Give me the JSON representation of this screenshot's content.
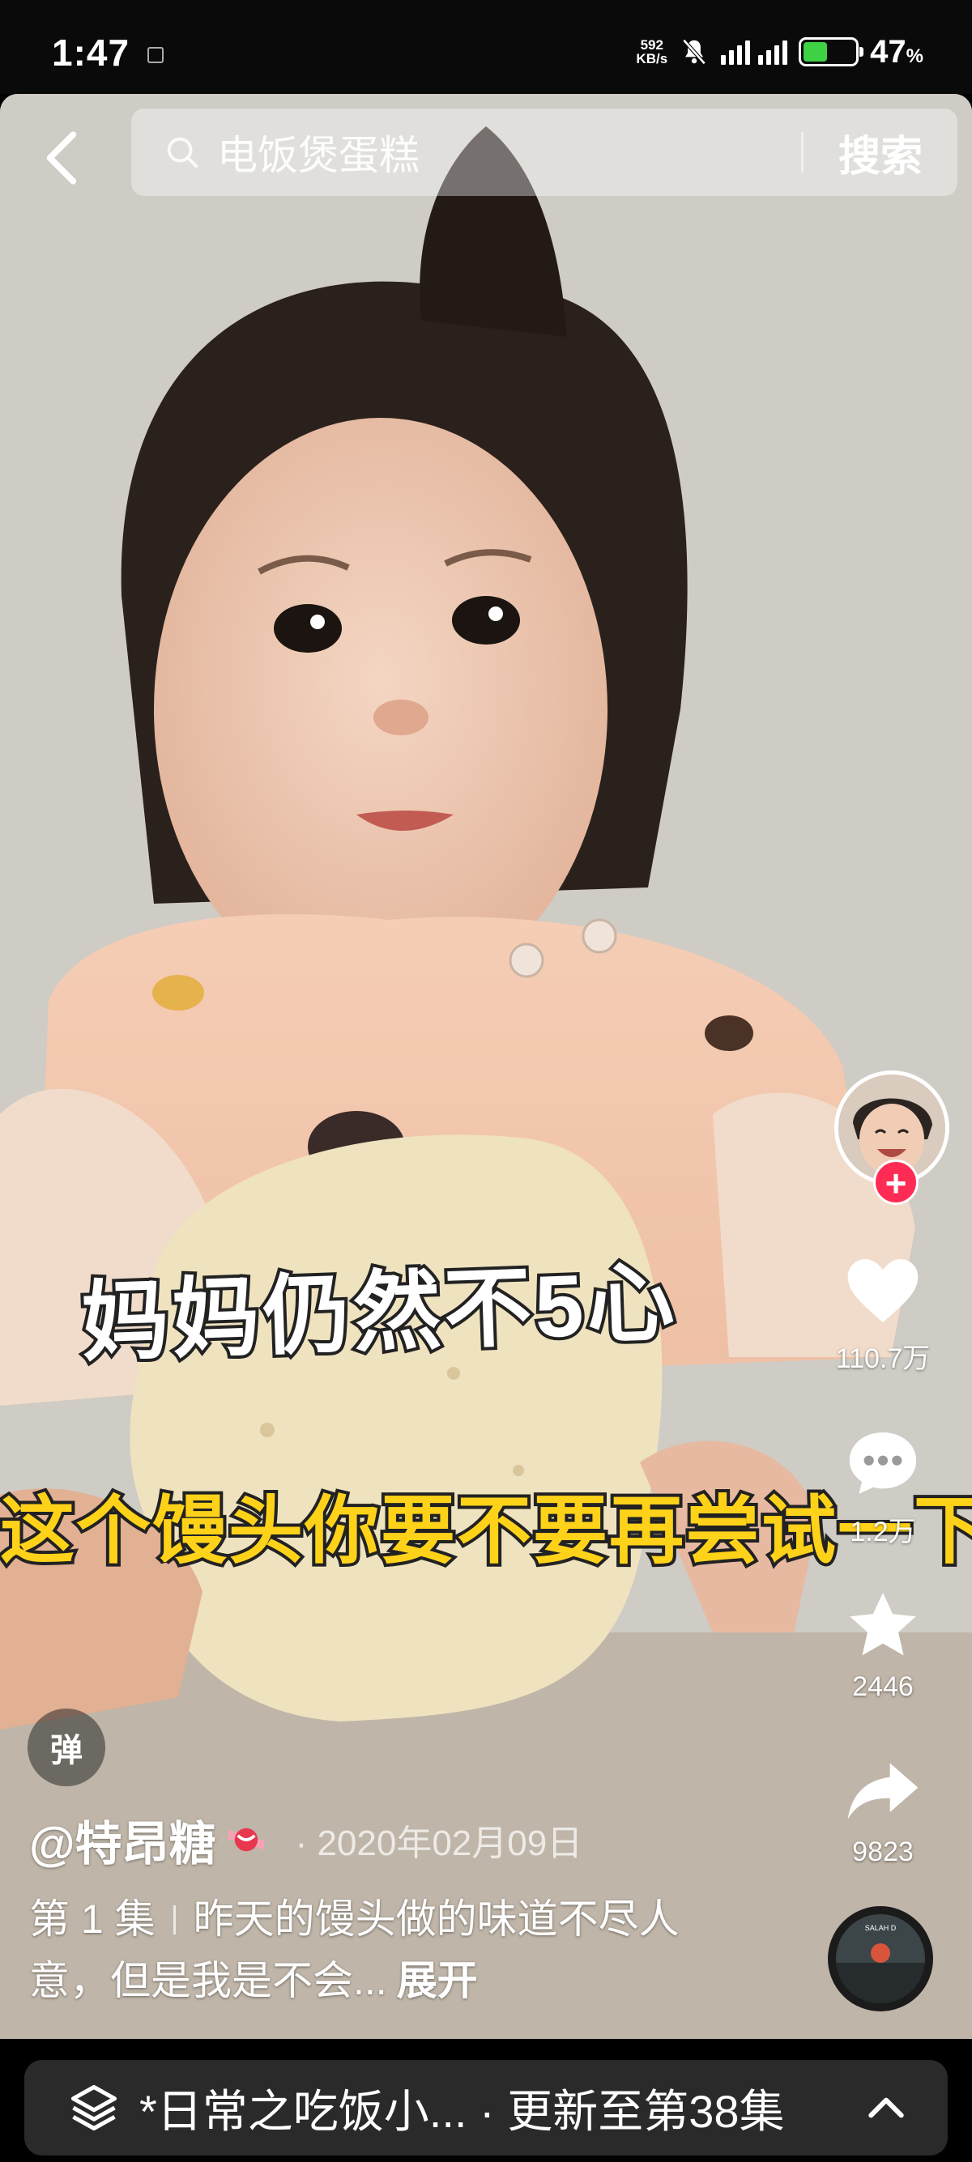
{
  "status_bar": {
    "time": "1:47",
    "net_speed_value": "592",
    "net_speed_unit": "KB/s",
    "battery_percent": "47",
    "battery_unit": "%",
    "battery_level": 0.47
  },
  "search": {
    "query": "电饭煲蛋糕",
    "button_label": "搜索"
  },
  "video": {
    "subtitle_line1": "妈妈仍然不5心",
    "subtitle_line2": "这个馒头你要不要再尝试一下"
  },
  "actions": {
    "follow_label": "+",
    "likes": "110.7万",
    "comments": "1.2万",
    "favorites": "2446",
    "shares": "9823",
    "music_disc_text": "SALAH D"
  },
  "danmu_label": "弹",
  "post": {
    "author": "@特昂糖",
    "date": "· 2020年02月09日",
    "episode": "第 1 集",
    "caption": "昨天的馒头做的味道不尽人意，但是我是不会...",
    "expand_label": "展开"
  },
  "collection": {
    "text": "*日常之吃饭小... · 更新至第38集"
  },
  "colors": {
    "follow_red": "#fe2c55",
    "subtitle_yellow": "#ffd21a",
    "battery_green": "#3ed143",
    "collection_bg": "#2a2a2a"
  }
}
